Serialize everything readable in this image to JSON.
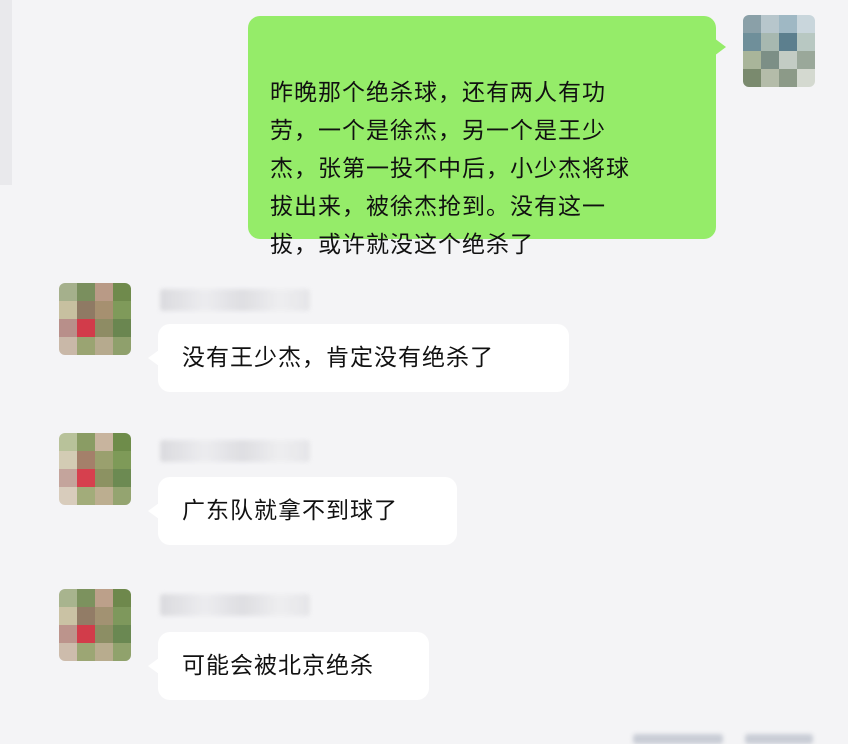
{
  "messages": [
    {
      "sender": "self",
      "text": "昨晚那个绝杀球，还有两人有功\n劳，一个是徐杰，另一个是王少\n杰，张第一投不中后，小少杰将球\n拔出来，被徐杰抢到。没有这一\n拔，或许就没这个绝杀了"
    },
    {
      "sender": "other",
      "text": "没有王少杰，肯定没有绝杀了"
    },
    {
      "sender": "other",
      "text": "广东队就拿不到球了"
    },
    {
      "sender": "other",
      "text": "可能会被北京绝杀"
    }
  ],
  "colors": {
    "self_bubble": "#95ec69",
    "other_bubble": "#ffffff",
    "background": "#f4f4f6"
  }
}
